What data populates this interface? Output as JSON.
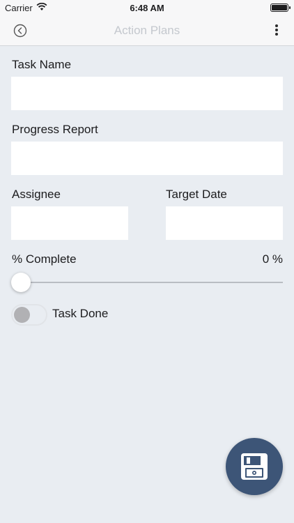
{
  "status_bar": {
    "carrier": "Carrier",
    "time": "6:48 AM"
  },
  "nav": {
    "title": "Action Plans",
    "back_icon": "chevron-left-circle-icon",
    "more_icon": "vertical-dots-icon"
  },
  "form": {
    "task_name_label": "Task Name",
    "task_name_value": "",
    "progress_report_label": "Progress Report",
    "progress_report_value": "",
    "assignee_label": "Assignee",
    "assignee_value": "",
    "target_date_label": "Target Date",
    "target_date_value": "",
    "percent_complete_label": "% Complete",
    "percent_complete_value_text": "0 %",
    "percent_complete_value": 0,
    "task_done_label": "Task Done",
    "task_done_on": false
  },
  "actions": {
    "save_icon": "floppy-disk-save-icon"
  },
  "colors": {
    "background": "#e9edf2",
    "fab": "#3d5577",
    "nav_title": "#c4c8ce"
  }
}
